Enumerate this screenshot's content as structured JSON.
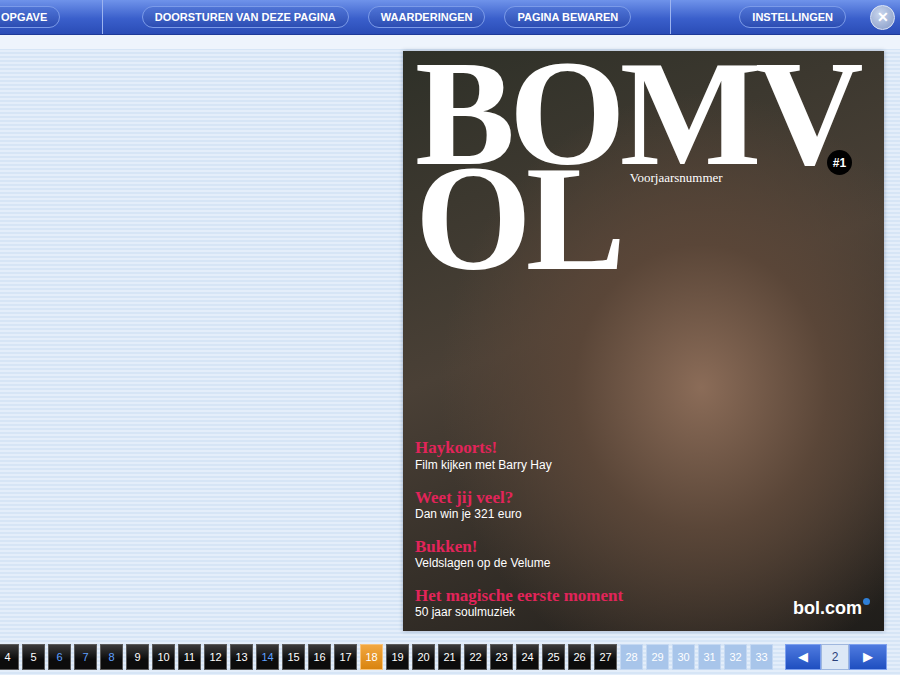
{
  "toolbar": {
    "groups": [
      {
        "buttons": [
          "OPGAVE"
        ]
      },
      {
        "buttons": [
          "DOORSTUREN VAN DEZE PAGINA",
          "WAARDERINGEN",
          "PAGINA BEWAREN"
        ]
      },
      {
        "buttons": [
          "INSTELLINGEN"
        ]
      }
    ],
    "close": "✕"
  },
  "cover": {
    "masthead": [
      "BOMV",
      "OL"
    ],
    "issue": "#1",
    "edition": "Voorjaarsnummer",
    "headlines": [
      {
        "title": "Haykoorts!",
        "subtitle": "Film kijken met Barry Hay"
      },
      {
        "title": "Weet jij veel?",
        "subtitle": "Dan win je 321 euro"
      },
      {
        "title": "Bukken!",
        "subtitle": "Veldslagen op de Velume"
      },
      {
        "title": "Het magische eerste moment",
        "subtitle": "50 jaar soulmuziek"
      }
    ],
    "logo": "bol.com"
  },
  "pager": {
    "pages": [
      {
        "label": "4",
        "selected": false,
        "visited": false,
        "available": true
      },
      {
        "label": "5",
        "selected": false,
        "visited": false,
        "available": true
      },
      {
        "label": "6",
        "selected": false,
        "visited": true,
        "available": true
      },
      {
        "label": "7",
        "selected": false,
        "visited": true,
        "available": true
      },
      {
        "label": "8",
        "selected": false,
        "visited": true,
        "available": true
      },
      {
        "label": "9",
        "selected": false,
        "visited": false,
        "available": true
      },
      {
        "label": "10",
        "selected": false,
        "visited": false,
        "available": true
      },
      {
        "label": "11",
        "selected": false,
        "visited": false,
        "available": true
      },
      {
        "label": "12",
        "selected": false,
        "visited": false,
        "available": true
      },
      {
        "label": "13",
        "selected": false,
        "visited": false,
        "available": true
      },
      {
        "label": "14",
        "selected": false,
        "visited": true,
        "available": true
      },
      {
        "label": "15",
        "selected": false,
        "visited": false,
        "available": true
      },
      {
        "label": "16",
        "selected": false,
        "visited": false,
        "available": true
      },
      {
        "label": "17",
        "selected": false,
        "visited": false,
        "available": true
      },
      {
        "label": "18",
        "selected": true,
        "visited": false,
        "available": true
      },
      {
        "label": "19",
        "selected": false,
        "visited": false,
        "available": true
      },
      {
        "label": "20",
        "selected": false,
        "visited": false,
        "available": true
      },
      {
        "label": "21",
        "selected": false,
        "visited": false,
        "available": true
      },
      {
        "label": "22",
        "selected": false,
        "visited": false,
        "available": true
      },
      {
        "label": "23",
        "selected": false,
        "visited": false,
        "available": true
      },
      {
        "label": "24",
        "selected": false,
        "visited": false,
        "available": true
      },
      {
        "label": "25",
        "selected": false,
        "visited": false,
        "available": true
      },
      {
        "label": "26",
        "selected": false,
        "visited": false,
        "available": true
      },
      {
        "label": "27",
        "selected": false,
        "visited": false,
        "available": true
      },
      {
        "label": "28",
        "selected": false,
        "visited": false,
        "available": false
      },
      {
        "label": "29",
        "selected": false,
        "visited": false,
        "available": false
      },
      {
        "label": "30",
        "selected": false,
        "visited": false,
        "available": false
      },
      {
        "label": "31",
        "selected": false,
        "visited": false,
        "available": false
      },
      {
        "label": "32",
        "selected": false,
        "visited": false,
        "available": false
      },
      {
        "label": "33",
        "selected": false,
        "visited": false,
        "available": false
      }
    ],
    "prev": "◀",
    "spread": "2",
    "next": "▶"
  }
}
